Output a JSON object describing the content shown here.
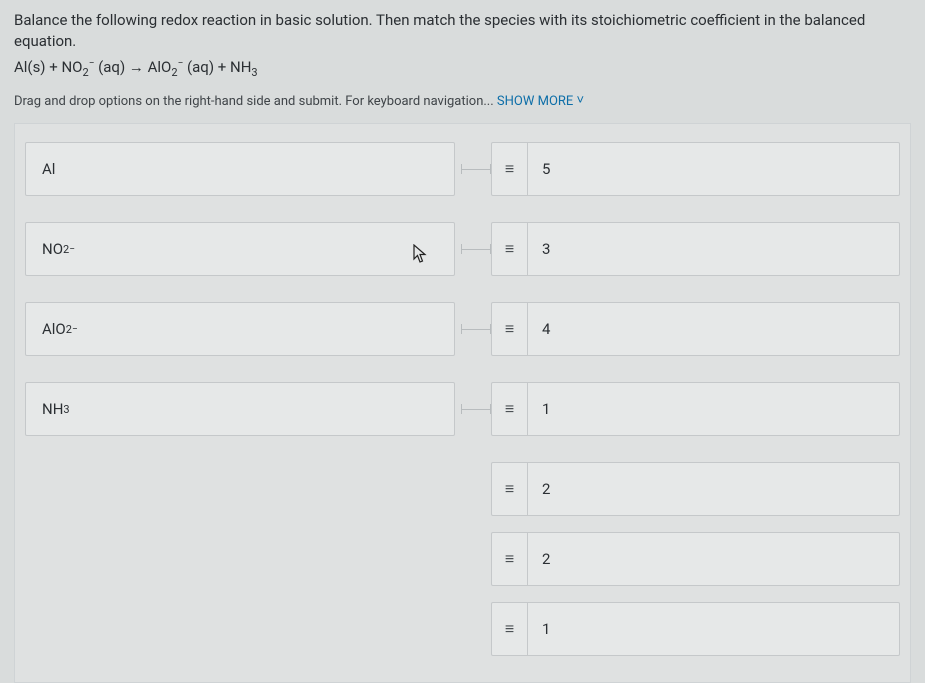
{
  "question": {
    "text": "Balance the following redox reaction in basic solution. Then match the species with its stoichiometric coefficient in the balanced equation.",
    "equation_parts": {
      "p1": "Al(s) + NO",
      "sub1": "2",
      "sup1": "−",
      "p2": " (aq) → AlO",
      "sub2": "2",
      "sup2": "−",
      "p3": " (aq) + NH",
      "sub3": "3"
    }
  },
  "instructions": {
    "text": "Drag and drop options on the right-hand side and submit. For keyboard navigation... ",
    "show_more": "SHOW MORE",
    "chevron": "˅"
  },
  "left_items": [
    {
      "kind": "plain",
      "label": "Al"
    },
    {
      "kind": "chem",
      "base": "NO",
      "sub": "2",
      "sup": "−"
    },
    {
      "kind": "chem",
      "base": "AlO",
      "sub": "2",
      "sup": "−"
    },
    {
      "kind": "chem",
      "base": "NH",
      "sub": "3",
      "sup": ""
    }
  ],
  "right_items": [
    {
      "value": "5"
    },
    {
      "value": "3"
    },
    {
      "value": "4"
    },
    {
      "value": "1"
    },
    {
      "value": "2"
    },
    {
      "value": "2"
    },
    {
      "value": "1"
    }
  ],
  "glyphs": {
    "grip": "≡"
  }
}
